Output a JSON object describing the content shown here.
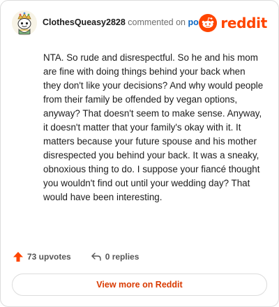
{
  "header": {
    "author": "ClothesQueasy2828",
    "commented_text": "commented on",
    "post_link": "post",
    "brand": "reddit"
  },
  "comment": {
    "text": "NTA. So rude and disrespectful. So he and his mom are fine with doing things behind your back when they don't like your decisions? And why would people from their family be offended by vegan options, anyway? That doesn't seem to make sense. Anyway, it doesn't matter that your family's okay with it. It matters because your future spouse and his mother disrespected you behind your back. It was a sneaky, obnoxious thing to do. I suppose your fiancé thought you wouldn't find out until your wedding day? That would have been interesting."
  },
  "actions": {
    "upvotes": "73 upvotes",
    "replies": "0 replies"
  },
  "footer": {
    "view_more": "View more on Reddit"
  },
  "colors": {
    "brand": "#ff4500",
    "upvote": "#ff4500",
    "link": "#0a66c2",
    "view_more_text": "#d93a00"
  },
  "icons": {
    "avatar": "snoo-avatar",
    "brand": "reddit-snoo-icon",
    "upvote": "upvote-arrow-icon",
    "reply": "reply-arrow-icon"
  }
}
